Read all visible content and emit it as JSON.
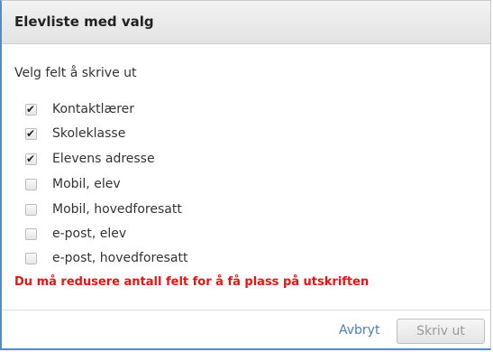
{
  "dialog": {
    "title": "Elevliste med valg",
    "subtitle": "Velg felt å skrive ut",
    "options": [
      {
        "label": "Kontaktlærer",
        "checked": true
      },
      {
        "label": "Skoleklasse",
        "checked": true
      },
      {
        "label": "Elevens adresse",
        "checked": true
      },
      {
        "label": "Mobil, elev",
        "checked": false
      },
      {
        "label": "Mobil, hovedforesatt",
        "checked": false
      },
      {
        "label": "e-post, elev",
        "checked": false
      },
      {
        "label": "e-post, hovedforesatt",
        "checked": false
      }
    ],
    "warning": "Du må redusere antall felt for å få plass på utskriften",
    "cancel_label": "Avbryt",
    "print_label": "Skriv ut",
    "print_disabled": true
  },
  "colors": {
    "warning": "#ee1111",
    "link": "#4a7fb8",
    "accent_border": "#4f8cc9"
  }
}
